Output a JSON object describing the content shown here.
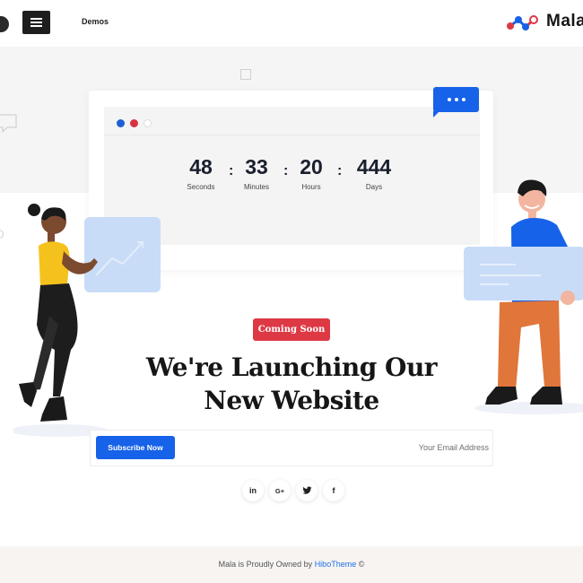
{
  "header": {
    "nav_demos": "Demos",
    "logo_text": "Mala",
    "menu_icon": "hamburger-icon"
  },
  "countdown": [
    {
      "value": "48",
      "label": "Seconds"
    },
    {
      "value": "33",
      "label": "Minutes"
    },
    {
      "value": "20",
      "label": "Hours"
    },
    {
      "value": "444",
      "label": "Days"
    }
  ],
  "countdown_separator": ":",
  "badge": "Coming Soon",
  "headline": {
    "line1": "We're Launching Our",
    "line2": "New Website"
  },
  "subscribe": {
    "button_label": "Subscribe Now",
    "placeholder": "Your Email Address"
  },
  "social": [
    {
      "icon": "linkedin-icon",
      "glyph": "in"
    },
    {
      "icon": "google-plus-icon",
      "glyph": "G+"
    },
    {
      "icon": "twitter-icon",
      "glyph": "tw"
    },
    {
      "icon": "facebook-icon",
      "glyph": "f"
    }
  ],
  "footer": {
    "text_before": "Mala is Proudly Owned by ",
    "link": "HiboTheme",
    "text_after": " ©"
  },
  "colors": {
    "accent_blue": "#1662e8",
    "accent_red": "#dd3945",
    "dark": "#1e1e1e",
    "footer_bg": "#f7f4f2"
  }
}
